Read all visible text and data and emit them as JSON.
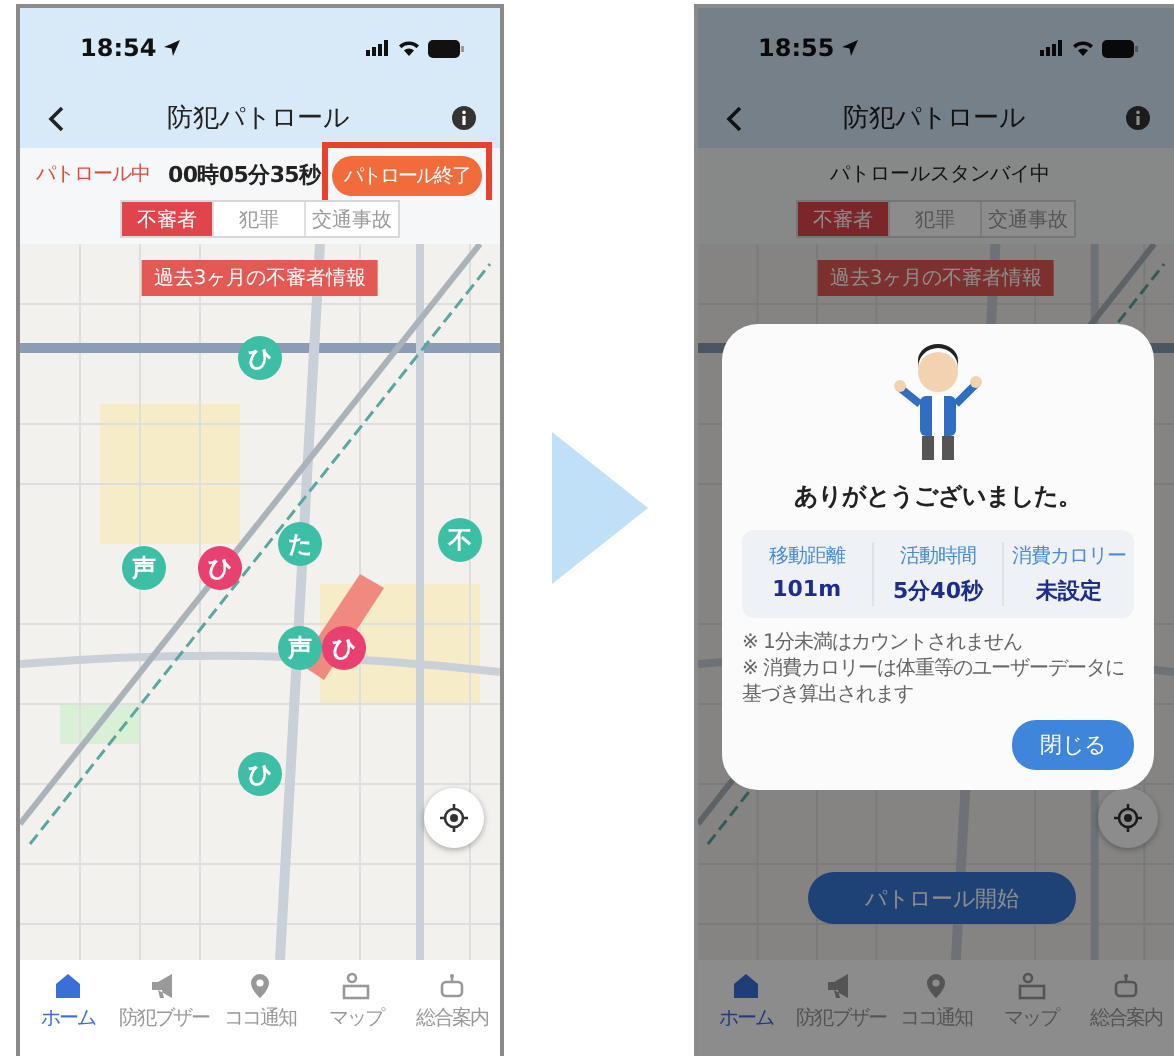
{
  "screens": [
    {
      "status_bar": {
        "time": "18:54"
      },
      "title": "防犯パトロール",
      "patrol": {
        "kind": "active",
        "status": "パトロール中",
        "timer": "00時05分35秒",
        "action": {
          "label": "パトロール終了",
          "highlighted": true
        }
      },
      "tabs": [
        {
          "label": "不審者",
          "selected": true
        },
        {
          "label": "犯罪",
          "selected": false
        },
        {
          "label": "交通事故",
          "selected": false
        }
      ],
      "map": {
        "banner": "過去3ヶ月の不審者情報",
        "markers": [
          {
            "glyph": "ひ",
            "color": "#3cbfa4"
          },
          {
            "glyph": "声",
            "color": "#3cbfa4"
          },
          {
            "glyph": "ひ",
            "color": "#e8416f"
          },
          {
            "glyph": "た",
            "color": "#3cbfa4"
          },
          {
            "glyph": "不",
            "color": "#3cbfa4"
          },
          {
            "glyph": "声",
            "color": "#3cbfa4"
          },
          {
            "glyph": "ひ",
            "color": "#e8416f"
          },
          {
            "glyph": "ひ",
            "color": "#3cbfa4"
          }
        ]
      },
      "nav": [
        {
          "label": "ホーム",
          "selected": true
        },
        {
          "label": "防犯ブザー",
          "selected": false
        },
        {
          "label": "ココ通知",
          "selected": false
        },
        {
          "label": "マップ",
          "selected": false
        },
        {
          "label": "総合案内",
          "selected": false
        }
      ]
    },
    {
      "status_bar": {
        "time": "18:55"
      },
      "title": "防犯パトロール",
      "patrol": {
        "kind": "standby",
        "status": "パトロールスタンバイ中"
      },
      "tabs": [
        {
          "label": "不審者",
          "selected": true
        },
        {
          "label": "犯罪",
          "selected": false
        },
        {
          "label": "交通事故",
          "selected": false
        }
      ],
      "map": {
        "banner": "過去3ヶ月の不審者情報",
        "start_button": "パトロール開始"
      },
      "nav": [
        {
          "label": "ホーム",
          "selected": true
        },
        {
          "label": "防犯ブザー",
          "selected": false
        },
        {
          "label": "ココ通知",
          "selected": false
        },
        {
          "label": "マップ",
          "selected": false
        },
        {
          "label": "総合案内",
          "selected": false
        }
      ],
      "dialog": {
        "message": "ありがとうございました。",
        "stats": [
          {
            "label": "移動距離",
            "value": "101m"
          },
          {
            "label": "活動時間",
            "value": "5分40秒"
          },
          {
            "label": "消費カロリー",
            "value": "未設定"
          }
        ],
        "notes": [
          "※ 1分未満はカウントされません",
          "※ 消費カロリーは体重等のユーザーデータに基づき算出されます"
        ],
        "close_button": "閉じる"
      }
    }
  ]
}
